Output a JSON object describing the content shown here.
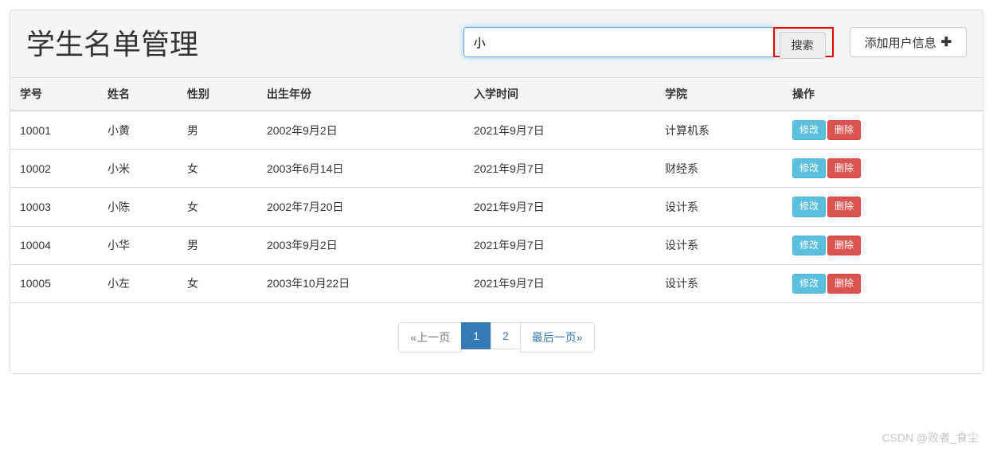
{
  "header": {
    "title": "学生名单管理",
    "search_value": "小",
    "search_button": "搜索",
    "add_button": "添加用户信息"
  },
  "table": {
    "columns": [
      "学号",
      "姓名",
      "性别",
      "出生年份",
      "入学时间",
      "学院",
      "操作"
    ],
    "rows": [
      {
        "id": "10001",
        "name": "小黄",
        "sex": "男",
        "birth": "2002年9月2日",
        "enroll": "2021年9月7日",
        "dept": "计算机系"
      },
      {
        "id": "10002",
        "name": "小米",
        "sex": "女",
        "birth": "2003年6月14日",
        "enroll": "2021年9月7日",
        "dept": "财经系"
      },
      {
        "id": "10003",
        "name": "小陈",
        "sex": "女",
        "birth": "2002年7月20日",
        "enroll": "2021年9月7日",
        "dept": "设计系"
      },
      {
        "id": "10004",
        "name": "小华",
        "sex": "男",
        "birth": "2003年9月2日",
        "enroll": "2021年9月7日",
        "dept": "设计系"
      },
      {
        "id": "10005",
        "name": "小左",
        "sex": "女",
        "birth": "2003年10月22日",
        "enroll": "2021年9月7日",
        "dept": "设计系"
      }
    ],
    "actions": {
      "edit": "修改",
      "delete": "删除"
    }
  },
  "pager": {
    "prev": "«上一页",
    "pages": [
      "1",
      "2"
    ],
    "active_index": 0,
    "last": "最后一页»"
  },
  "watermark": "CSDN @败者_食尘"
}
